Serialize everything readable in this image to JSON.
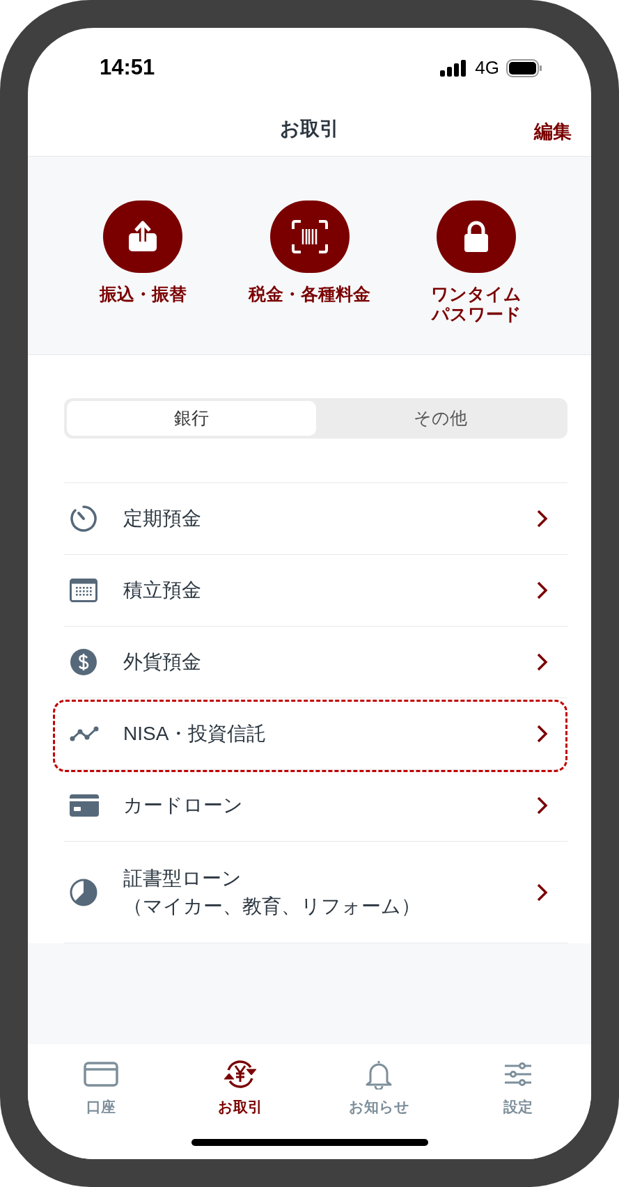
{
  "status_bar": {
    "time": "14:51",
    "network": "4G"
  },
  "header": {
    "title": "お取引",
    "action": "編集"
  },
  "quick_actions": [
    {
      "kind": "transfer",
      "label_lines": [
        "振込・振替"
      ]
    },
    {
      "kind": "bills",
      "label_lines": [
        "税金・各種料金"
      ]
    },
    {
      "kind": "otp",
      "label_lines": [
        "ワンタイム",
        "パスワード"
      ]
    }
  ],
  "segments": [
    {
      "label": "銀行",
      "selected": true
    },
    {
      "label": "その他",
      "selected": false
    }
  ],
  "items": [
    {
      "kind": "timer",
      "label": "定期預金",
      "highlighted": false
    },
    {
      "kind": "calendar",
      "label": "積立預金",
      "highlighted": false
    },
    {
      "kind": "dollar",
      "label": "外貨預金",
      "highlighted": false
    },
    {
      "kind": "chart",
      "label": "NISA・投資信託",
      "highlighted": true
    },
    {
      "kind": "card",
      "label": "カードローン",
      "highlighted": false
    },
    {
      "kind": "pie",
      "label": "証書型ローン",
      "sublabel": "（マイカー、教育、リフォーム）",
      "highlighted": false
    }
  ],
  "tab_bar": [
    {
      "kind": "account",
      "label": "口座",
      "selected": false
    },
    {
      "kind": "trade",
      "label": "お取引",
      "selected": true
    },
    {
      "kind": "bell",
      "label": "お知らせ",
      "selected": false
    },
    {
      "kind": "settings",
      "label": "設定",
      "selected": false
    }
  ]
}
